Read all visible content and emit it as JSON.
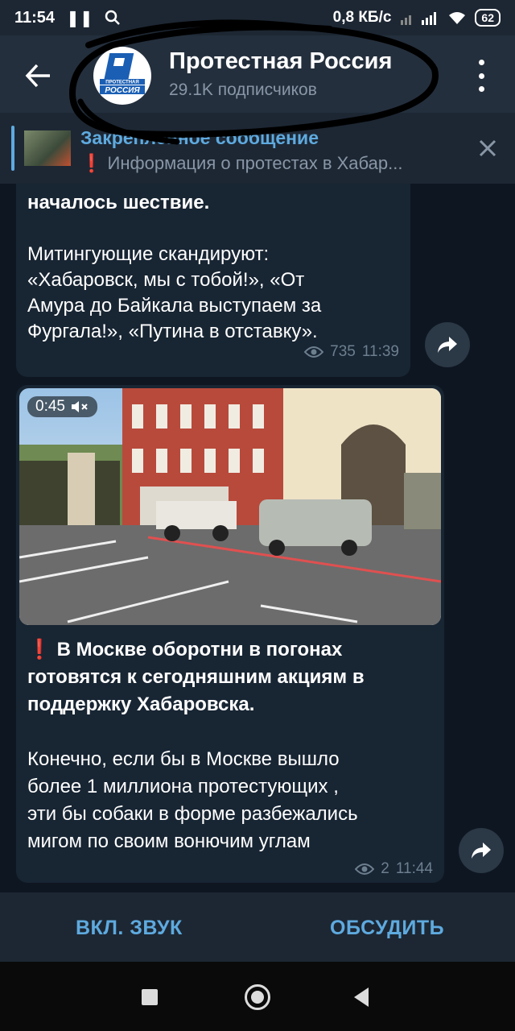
{
  "status": {
    "time": "11:54",
    "net_speed": "0,8 КБ/с",
    "battery": "62"
  },
  "header": {
    "channel_name": "Протестная Россия",
    "subscribers": "29.1K подписчиков",
    "avatar_text": [
      "ПРОТЕСТНАЯ",
      "РОССИЯ"
    ]
  },
  "pinned": {
    "title": "Закреплённое сообщение",
    "text": "Информация о протестах в Хабар..."
  },
  "messages": [
    {
      "first_line": "началось шествие.",
      "body": "Митингующие скандируют:\n«Хабаровск, мы с тобой!», «От\nАмура до Байкала выступаем за\nФургала!», «Путина в отставку».",
      "views": "735",
      "time": "11:39"
    },
    {
      "video_duration": "0:45",
      "title": "В Москве оборотни в погонах готовятся к сегодняшним акциям в поддержку Хабаровска.",
      "body": "Конечно, если бы в Москве вышло\nболее 1 миллиона протестующих ,\nэти бы собаки в форме разбежались\nмигом по своим вонючим углам",
      "views": "2",
      "time": "11:44",
      "exclamation": "❗"
    }
  ],
  "bottom_bar": {
    "sound_label": "ВКЛ. ЗВУК",
    "discuss_label": "ОБСУДИТЬ"
  },
  "pin_exclamation": "❗",
  "colors": {
    "accent": "#5eaadf",
    "header_bg": "#242f3d",
    "chat_bg": "#0e1621",
    "bubble_bg": "#182533",
    "alert_red": "#e53935"
  }
}
